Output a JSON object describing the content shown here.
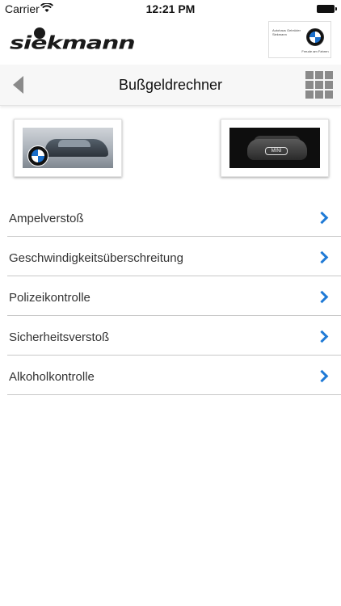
{
  "status_bar": {
    "carrier": "Carrier",
    "time": "12:21 PM"
  },
  "brand": {
    "logo_text": "siekmann",
    "dealer_badge_text": "Autohaus Gebrüder Siekmann",
    "dealer_badge_subtext": "Freude am Fahren"
  },
  "nav": {
    "title": "Bußgeldrechner"
  },
  "brands": [
    {
      "name": "BMW"
    },
    {
      "name": "MINI"
    }
  ],
  "menu": {
    "items": [
      {
        "label": "Ampelverstoß"
      },
      {
        "label": "Geschwindigkeitsüberschreitung"
      },
      {
        "label": "Polizeikontrolle"
      },
      {
        "label": "Sicherheitsverstoß"
      },
      {
        "label": "Alkoholkontrolle"
      }
    ]
  },
  "colors": {
    "accent": "#1f7ad6",
    "icon_gray": "#8a8a8a",
    "divider": "#c8c8c8"
  },
  "icons": {
    "back": "back-arrow-icon",
    "menu": "grid-menu-icon",
    "chevron": "chevron-right-icon"
  }
}
